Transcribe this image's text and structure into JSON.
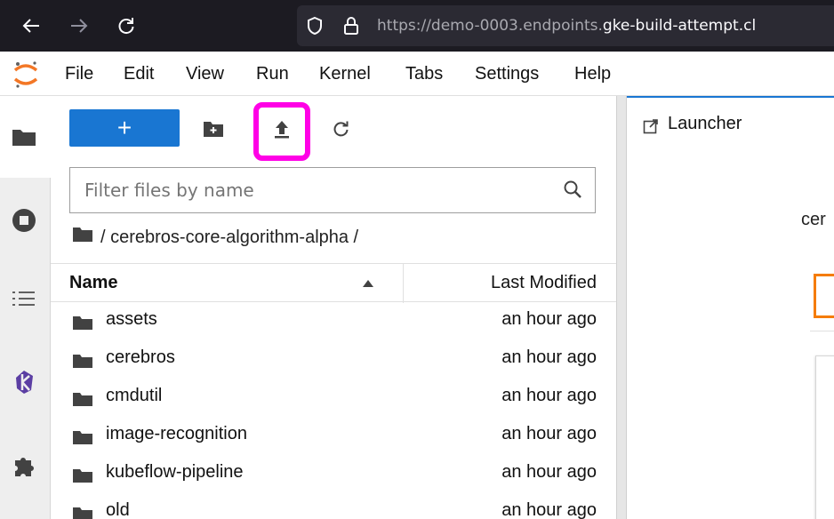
{
  "browser": {
    "url_dim": "https://demo-0003.endpoints.",
    "url_bright": "gke-build-attempt.cl",
    "icons": [
      "back-arrow-icon",
      "forward-arrow-icon",
      "reload-icon",
      "shield-icon",
      "lock-icon"
    ]
  },
  "menu": {
    "items": [
      "File",
      "Edit",
      "View",
      "Run",
      "Kernel",
      "Tabs",
      "Settings",
      "Help"
    ]
  },
  "activity": {
    "icons": [
      "folder-icon",
      "stop-circle-icon",
      "list-icon",
      "kubeflow-icon",
      "extension-puzzle-icon"
    ]
  },
  "filebrowser": {
    "new_label": "+",
    "filter_placeholder": "Filter files by name",
    "breadcrumb": "/ cerebros-core-algorithm-alpha /",
    "columns": {
      "name": "Name",
      "modified": "Last Modified"
    },
    "rows": [
      {
        "name": "assets",
        "modified": "an hour ago"
      },
      {
        "name": "cerebros",
        "modified": "an hour ago"
      },
      {
        "name": "cmdutil",
        "modified": "an hour ago"
      },
      {
        "name": "image-recognition",
        "modified": "an hour ago"
      },
      {
        "name": "kubeflow-pipeline",
        "modified": "an hour ago"
      },
      {
        "name": "old",
        "modified": "an hour ago"
      }
    ]
  },
  "main": {
    "tab_label": "Launcher",
    "heading_partial": "cer"
  },
  "colors": {
    "accent": "#1976d2",
    "highlight": "#ff00e6",
    "orange": "#f57c00"
  }
}
